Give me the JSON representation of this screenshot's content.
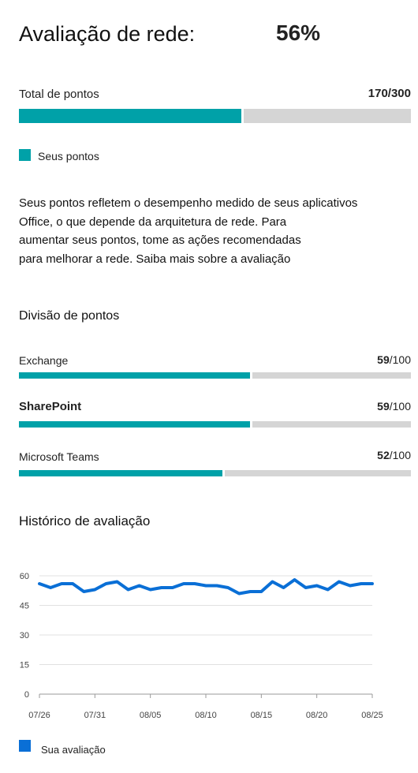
{
  "header": {
    "title": "Avaliação de rede:",
    "percent": "56%"
  },
  "total": {
    "label": "Total de pontos",
    "value": "170/300",
    "score": 170,
    "max": 300
  },
  "legend": {
    "label": "Seus pontos",
    "color": "#00a1a8"
  },
  "description": [
    "Seus pontos refletem o desempenho medido de seus aplicativos",
    "Office, o que depende da arquitetura de rede. Para",
    "aumentar seus pontos, tome as ações recomendadas",
    "para melhorar a rede. Saiba mais sobre a avaliação"
  ],
  "breakdown": {
    "title": "Divisão de pontos",
    "items": [
      {
        "label": "Exchange",
        "score": "59",
        "max": "/100",
        "value": 59,
        "of": 100
      },
      {
        "label": "SharePoint",
        "score": "59",
        "max": "/100",
        "value": 59,
        "of": 100
      },
      {
        "label": "Microsoft Teams",
        "score": "52",
        "max": "/100",
        "value": 52,
        "of": 100
      }
    ]
  },
  "history": {
    "title": "Histórico de avaliação",
    "legend_label": "Sua avaliação",
    "legend_color": "#0a6fd6"
  },
  "chart_data": {
    "type": "line",
    "title": "Histórico de avaliação",
    "xlabel": "",
    "ylabel": "",
    "ylim": [
      0,
      60
    ],
    "yticks": [
      0,
      15,
      30,
      45,
      60
    ],
    "xticks": [
      "07/26",
      "07/31",
      "08/05",
      "08/10",
      "08/15",
      "08/20",
      "08/25"
    ],
    "grid": true,
    "legend_position": "bottom-left",
    "series": [
      {
        "name": "Sua avaliação",
        "color": "#0a6fd6",
        "x": [
          "07/26",
          "07/27",
          "07/28",
          "07/29",
          "07/30",
          "07/31",
          "08/01",
          "08/02",
          "08/03",
          "08/04",
          "08/05",
          "08/06",
          "08/07",
          "08/08",
          "08/09",
          "08/10",
          "08/11",
          "08/12",
          "08/13",
          "08/14",
          "08/15",
          "08/16",
          "08/17",
          "08/18",
          "08/19",
          "08/20",
          "08/21",
          "08/22",
          "08/23",
          "08/24",
          "08/25"
        ],
        "values": [
          56,
          54,
          56,
          56,
          52,
          53,
          56,
          57,
          53,
          55,
          53,
          54,
          54,
          56,
          56,
          55,
          55,
          54,
          51,
          52,
          52,
          57,
          54,
          58,
          54,
          55,
          53,
          57,
          55,
          56,
          56
        ]
      }
    ]
  }
}
